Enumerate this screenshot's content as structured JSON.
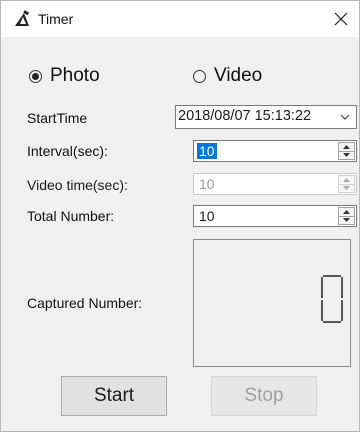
{
  "window": {
    "title": "Timer"
  },
  "mode": {
    "options": [
      {
        "label": "Photo",
        "checked": true
      },
      {
        "label": "Video",
        "checked": false
      }
    ]
  },
  "fields": {
    "start_time": {
      "label": "StartTime",
      "value": "2018/08/07 15:13:22"
    },
    "interval": {
      "label": "Interval(sec):",
      "value": "10"
    },
    "video_time": {
      "label": "Video time(sec):",
      "value": "10",
      "disabled": true
    },
    "total_number": {
      "label": "Total Number:",
      "value": "10"
    },
    "captured_number": {
      "label": "Captured Number:",
      "value": "0"
    }
  },
  "buttons": {
    "start": {
      "label": "Start",
      "enabled": true
    },
    "stop": {
      "label": "Stop",
      "enabled": false
    }
  },
  "colors": {
    "selection": "#0078d7",
    "window_bg": "#f0f0f0",
    "titlebar_bg": "#ffffff"
  }
}
